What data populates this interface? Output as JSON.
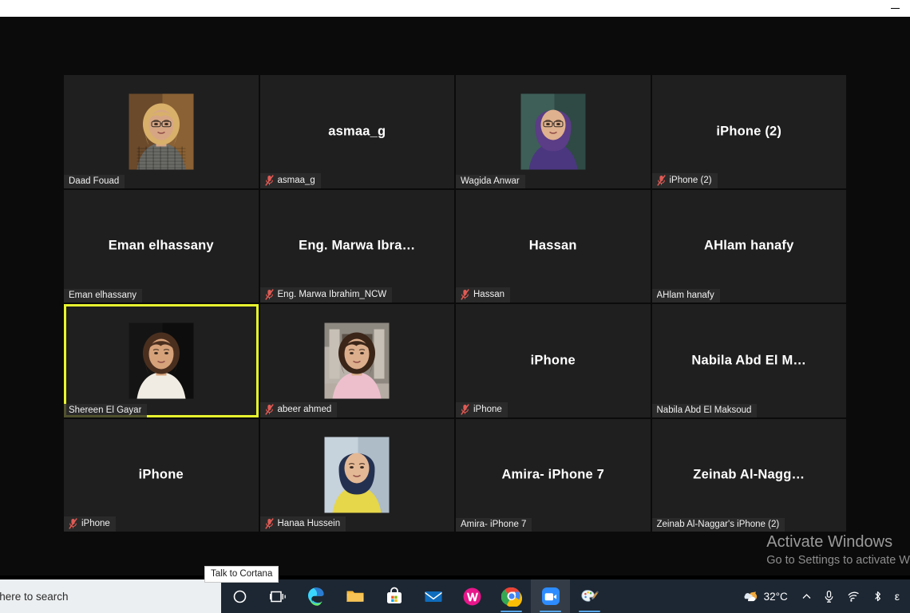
{
  "window": {
    "minimize_label": "minimize"
  },
  "meeting": {
    "active_speaker": "Shereen El Gayar",
    "accent_active_border": "#e7f52e",
    "tiles": [
      {
        "big_name": "",
        "strip_name": "Daad Fouad",
        "muted": false,
        "has_video": true,
        "photo": "woman-blonde-glasses"
      },
      {
        "big_name": "asmaa_g",
        "strip_name": "asmaa_g",
        "muted": true,
        "has_video": false,
        "photo": ""
      },
      {
        "big_name": "",
        "strip_name": "Wagida Anwar",
        "muted": false,
        "has_video": true,
        "photo": "woman-purple-headscarf"
      },
      {
        "big_name": "iPhone (2)",
        "strip_name": "iPhone (2)",
        "muted": true,
        "has_video": false,
        "photo": ""
      },
      {
        "big_name": "Eman elhassany",
        "strip_name": "Eman elhassany",
        "muted": false,
        "has_video": false,
        "photo": ""
      },
      {
        "big_name": "Eng. Marwa Ibra…",
        "strip_name": "Eng. Marwa Ibrahim_NCW",
        "muted": true,
        "has_video": false,
        "photo": ""
      },
      {
        "big_name": "Hassan",
        "strip_name": "Hassan",
        "muted": true,
        "has_video": false,
        "photo": ""
      },
      {
        "big_name": "AHlam hanafy",
        "strip_name": "AHlam hanafy",
        "muted": false,
        "has_video": false,
        "photo": ""
      },
      {
        "big_name": "",
        "strip_name": "Shereen El Gayar",
        "muted": false,
        "has_video": true,
        "photo": "woman-white-blouse",
        "active": true
      },
      {
        "big_name": "",
        "strip_name": "abeer ahmed",
        "muted": true,
        "has_video": true,
        "photo": "woman-pink-jacket-street"
      },
      {
        "big_name": "iPhone",
        "strip_name": "iPhone",
        "muted": true,
        "has_video": false,
        "photo": ""
      },
      {
        "big_name": "Nabila Abd El M…",
        "strip_name": "Nabila Abd El Maksoud",
        "muted": false,
        "has_video": false,
        "photo": ""
      },
      {
        "big_name": "iPhone",
        "strip_name": "iPhone",
        "muted": true,
        "has_video": false,
        "photo": ""
      },
      {
        "big_name": "",
        "strip_name": "Hanaa Hussein",
        "muted": true,
        "has_video": true,
        "photo": "woman-navy-headscarf"
      },
      {
        "big_name": "Amira- iPhone 7",
        "strip_name": "Amira- iPhone 7",
        "muted": false,
        "has_video": false,
        "photo": ""
      },
      {
        "big_name": "Zeinab  Al-Nagg…",
        "strip_name": "Zeinab Al-Naggar's iPhone (2)",
        "muted": false,
        "has_video": false,
        "photo": ""
      }
    ]
  },
  "watermark": {
    "title": "Activate Windows",
    "subtitle": "Go to Settings to activate W"
  },
  "tooltip": {
    "cortana": "Talk to Cortana"
  },
  "taskbar": {
    "search_placeholder": "e here to search",
    "buttons": [
      {
        "name": "cortana",
        "label": "Cortana"
      },
      {
        "name": "task-view",
        "label": "Task View"
      }
    ],
    "apps": [
      {
        "name": "microsoft-edge",
        "label": "Microsoft Edge",
        "running": true,
        "active": false
      },
      {
        "name": "file-explorer",
        "label": "File Explorer",
        "running": true,
        "active": false
      },
      {
        "name": "microsoft-store",
        "label": "Microsoft Store",
        "running": false,
        "active": false
      },
      {
        "name": "mail",
        "label": "Mail",
        "running": false,
        "active": false
      },
      {
        "name": "wps-office",
        "label": "WPS Office",
        "running": false,
        "active": false
      },
      {
        "name": "google-chrome",
        "label": "Google Chrome",
        "running": true,
        "active": false
      },
      {
        "name": "zoom",
        "label": "Zoom",
        "running": true,
        "active": true
      },
      {
        "name": "paint",
        "label": "Paint",
        "running": true,
        "active": false
      }
    ],
    "tray": {
      "temperature": "32°C",
      "weather_icon": "partly-cloudy-sun-icon",
      "show_hidden_icons": "^",
      "microphone": "microphone-icon",
      "network": "wifi-icon",
      "bluetooth": "bluetooth-icon",
      "ime": "ε"
    }
  }
}
